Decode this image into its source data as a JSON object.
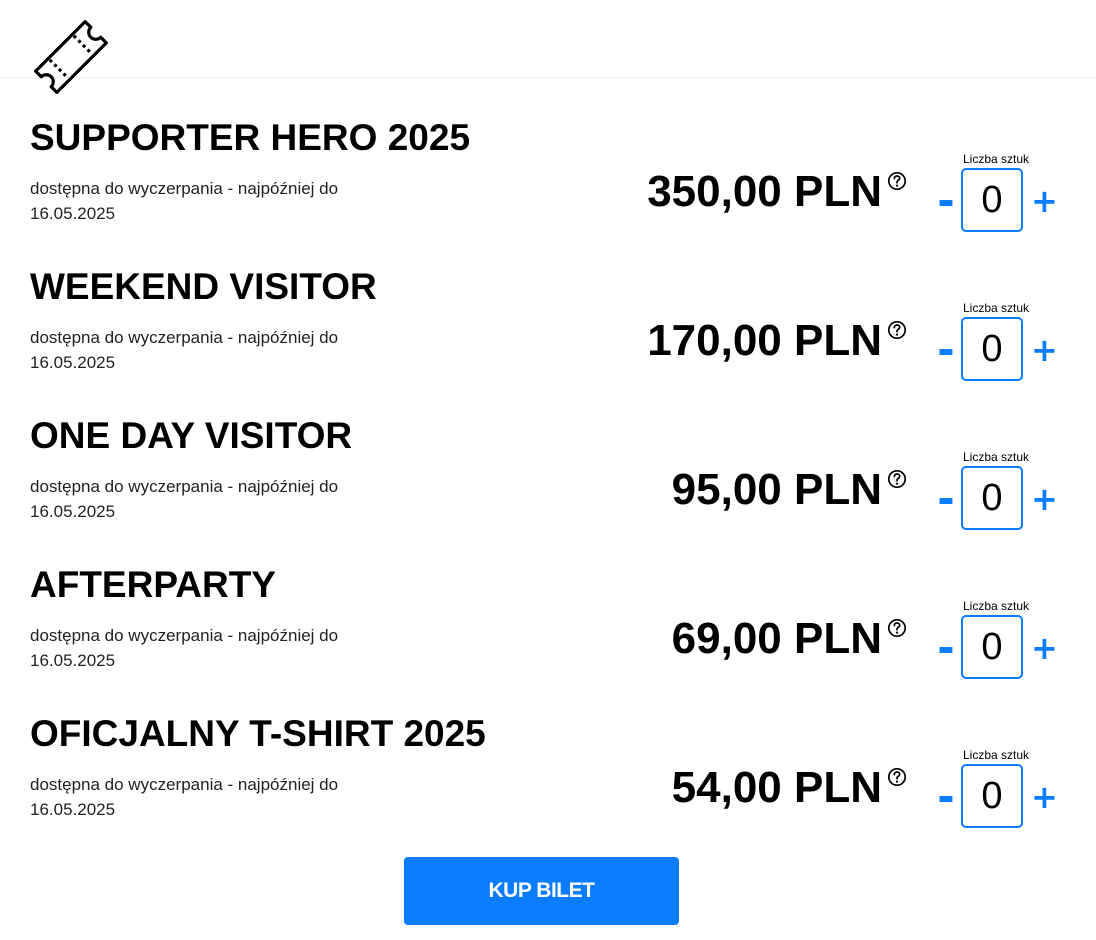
{
  "header": {
    "icon": "ticket-icon"
  },
  "tickets": [
    {
      "name": "SUPPORTER HERO 2025",
      "availability": "dostępna do wyczerpania - najpóźniej do 16.05.2025",
      "price": "350,00 PLN",
      "quantity_label": "Liczba sztuk",
      "quantity": "0",
      "minus": "-",
      "plus": "+"
    },
    {
      "name": "WEEKEND VISITOR",
      "availability": "dostępna do wyczerpania - najpóźniej do 16.05.2025",
      "price": "170,00 PLN",
      "quantity_label": "Liczba sztuk",
      "quantity": "0",
      "minus": "-",
      "plus": "+"
    },
    {
      "name": "ONE DAY VISITOR",
      "availability": "dostępna do wyczerpania - najpóźniej do 16.05.2025",
      "price": "95,00 PLN",
      "quantity_label": "Liczba sztuk",
      "quantity": "0",
      "minus": "-",
      "plus": "+"
    },
    {
      "name": "AFTERPARTY",
      "availability": "dostępna do wyczerpania - najpóźniej do 16.05.2025",
      "price": "69,00 PLN",
      "quantity_label": "Liczba sztuk",
      "quantity": "0",
      "minus": "-",
      "plus": "+"
    },
    {
      "name": "OFICJALNY T-SHIRT 2025",
      "availability": "dostępna do wyczerpania - najpóźniej do 16.05.2025",
      "price": "54,00 PLN",
      "quantity_label": "Liczba sztuk",
      "quantity": "0",
      "minus": "-",
      "plus": "+"
    }
  ],
  "buy_button": {
    "label": "KUP BILET"
  },
  "colors": {
    "accent": "#0a7cff",
    "text": "#000000",
    "background": "#ffffff"
  }
}
